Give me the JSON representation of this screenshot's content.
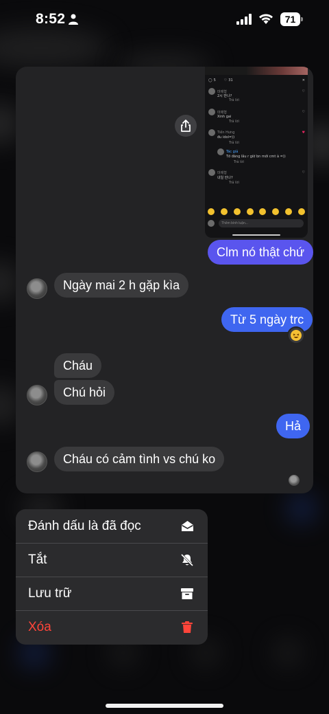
{
  "status_bar": {
    "time": "8:52",
    "battery": "71"
  },
  "shared_post": {
    "counts": [
      "5",
      "31"
    ],
    "comments": [
      {
        "user": "마제형",
        "text": "2시 만나?",
        "meta": "Trả lời"
      },
      {
        "user": "마제형",
        "text": "Xinh gai",
        "meta": "Trả lời"
      },
      {
        "user": "Tiến Hưng",
        "text": "đu idol=))",
        "meta": "Trả lời"
      },
      {
        "user": "Tác giả",
        "text": "Tớ đăng lâu r giờ bn mới cmt à =))",
        "meta": "Trả lời"
      },
      {
        "user": "마제형",
        "text": "내일 만나?",
        "meta": "Trả lời"
      }
    ],
    "input_placeholder": "Thêm bình luận..."
  },
  "messages": [
    {
      "side": "out",
      "text": "Clm nó thật chứ"
    },
    {
      "side": "in",
      "text": "Ngày mai 2 h gặp kìa"
    },
    {
      "side": "out",
      "text": "Từ 5 ngày trc"
    },
    {
      "side": "in",
      "text": "Cháu"
    },
    {
      "side": "in",
      "text": "Chú hỏi"
    },
    {
      "side": "out",
      "text": "Hả"
    },
    {
      "side": "in",
      "text": "Cháu có cảm tình vs chú ko"
    }
  ],
  "menu": {
    "items": [
      {
        "label": "Đánh dấu là đã đọc",
        "icon": "envelope-open-icon"
      },
      {
        "label": "Tắt",
        "icon": "bell-slash-icon"
      },
      {
        "label": "Lưu trữ",
        "icon": "archive-box-icon"
      },
      {
        "label": "Xóa",
        "icon": "trash-icon"
      }
    ]
  },
  "colors": {
    "outgoing": "#5a55ee",
    "outgoing_alt": "#3f66f0",
    "incoming": "#3a3a3c",
    "danger": "#ff453a"
  }
}
